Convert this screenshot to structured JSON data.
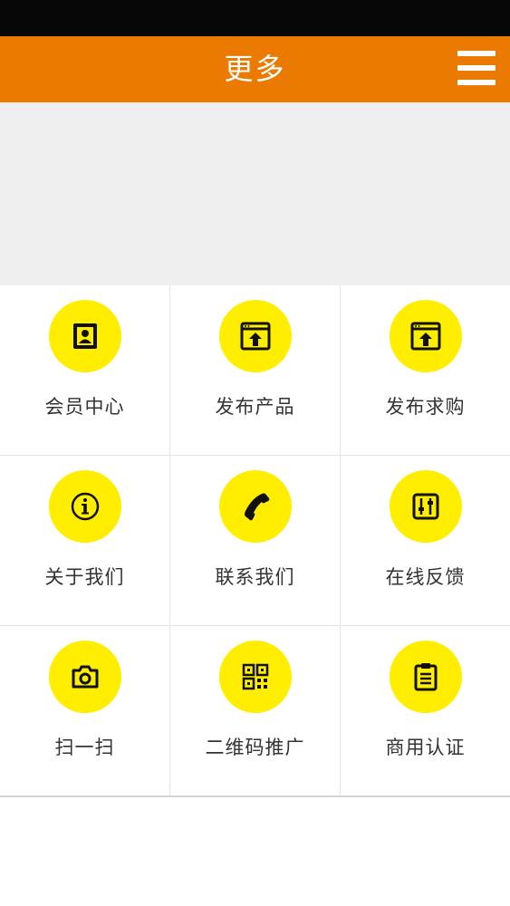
{
  "header": {
    "title": "更多"
  },
  "colors": {
    "status_bar": "#060606",
    "header_bg": "#ea7a00",
    "icon_circle": "#ffee00",
    "banner_bg": "#efefef"
  },
  "grid": {
    "items": [
      {
        "label": "会员中心",
        "icon": "member-card-icon"
      },
      {
        "label": "发布产品",
        "icon": "publish-upload-icon"
      },
      {
        "label": "发布求购",
        "icon": "publish-upload-icon"
      },
      {
        "label": "关于我们",
        "icon": "info-icon"
      },
      {
        "label": "联系我们",
        "icon": "phone-icon"
      },
      {
        "label": "在线反馈",
        "icon": "sliders-icon"
      },
      {
        "label": "扫一扫",
        "icon": "camera-icon"
      },
      {
        "label": "二维码推广",
        "icon": "qr-code-icon"
      },
      {
        "label": "商用认证",
        "icon": "clipboard-icon"
      }
    ]
  }
}
